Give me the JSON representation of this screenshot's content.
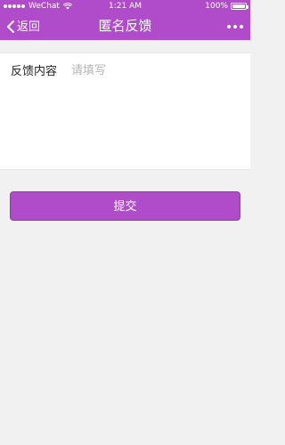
{
  "colors": {
    "accent": "#b04cc9",
    "background": "#f1f1f1"
  },
  "status_bar": {
    "carrier": "WeChat",
    "time": "1:21 AM",
    "battery": "100%"
  },
  "navbar": {
    "back_label": "返回",
    "title": "匿名反馈",
    "more_icon": "more-icon"
  },
  "form": {
    "label": "反馈内容",
    "placeholder": "请填写",
    "value": ""
  },
  "submit": {
    "label": "提交"
  }
}
